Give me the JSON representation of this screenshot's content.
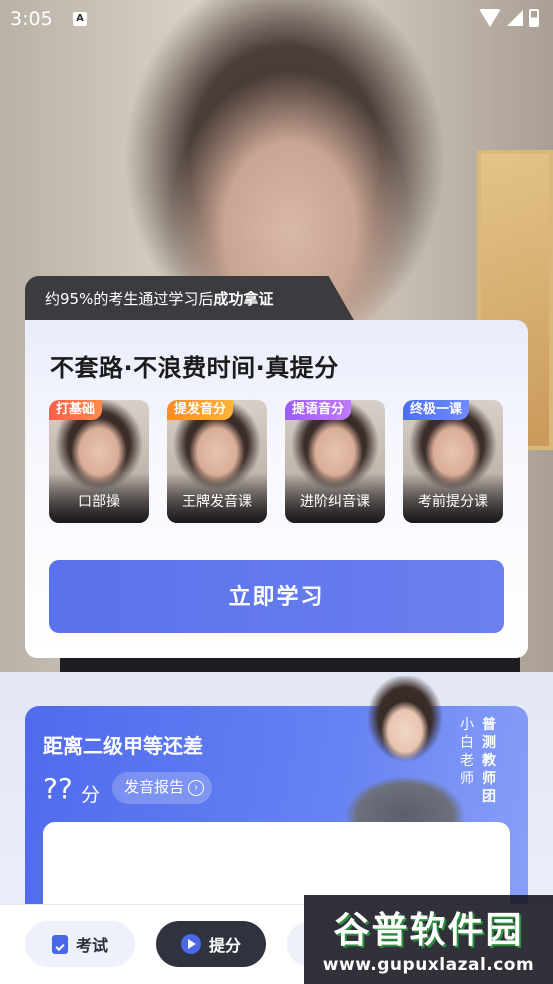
{
  "status_bar": {
    "time": "3:05",
    "app_icon": "A"
  },
  "promo": {
    "stat_prefix": "约95%的考生通过学习后",
    "stat_strong": "成功拿证",
    "title": "不套路·不浪费时间·真提分",
    "courses": [
      {
        "tag": "打基础",
        "name": "口部操",
        "tag_color": "#ff5f4a"
      },
      {
        "tag": "提发音分",
        "name": "王牌发音课",
        "tag_color": "#ff8a1f"
      },
      {
        "tag": "提语音分",
        "name": "进阶纠音课",
        "tag_color": "#9b5cf6"
      },
      {
        "tag": "终极一课",
        "name": "考前提分课",
        "tag_color": "#4c6ef5"
      }
    ],
    "study_button": "立即学习"
  },
  "score": {
    "title": "距离二级甲等还差",
    "value": "??",
    "unit": "分",
    "report_button": "发音报告",
    "teacher_name": "小白老师",
    "teacher_team": "普测教师团"
  },
  "nav": {
    "exam": "考试",
    "boost": "提分"
  },
  "watermark": {
    "title": "谷普软件园",
    "url": "www.gupuxlazal.com"
  }
}
